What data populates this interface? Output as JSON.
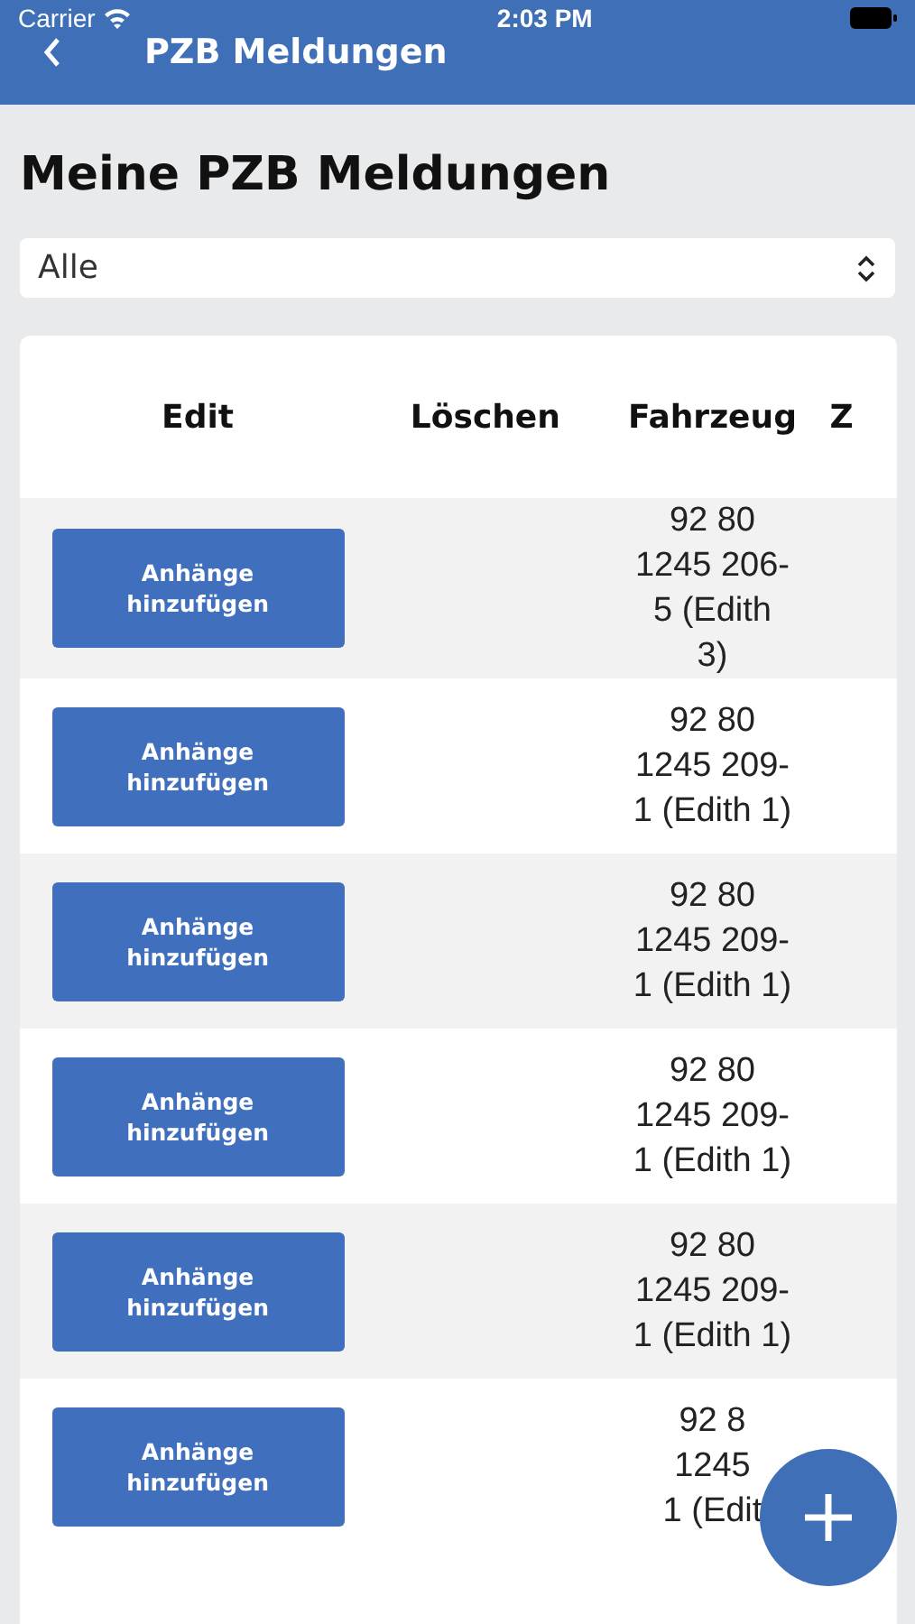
{
  "status_bar": {
    "carrier": "Carrier",
    "time": "2:03 PM"
  },
  "nav_bar": {
    "title": "PZB Meldungen"
  },
  "heading": "Meine PZB Meldungen",
  "filter": {
    "value": "Alle"
  },
  "table": {
    "columns": [
      "Edit",
      "Löschen",
      "Fahrzeug",
      "Z"
    ],
    "rows": [
      {
        "edit": "Anhänge hinzufügen",
        "fahrzeug": [
          "92 80",
          "1245 206-",
          "5 (Edith",
          "3)"
        ]
      },
      {
        "edit": "Anhänge hinzufügen",
        "fahrzeug": [
          "92 80",
          "1245 209-",
          "1 (Edith 1)"
        ]
      },
      {
        "edit": "Anhänge hinzufügen",
        "fahrzeug": [
          "92 80",
          "1245 209-",
          "1 (Edith 1)"
        ]
      },
      {
        "edit": "Anhänge hinzufügen",
        "fahrzeug": [
          "92 80",
          "1245 209-",
          "1 (Edith 1)"
        ]
      },
      {
        "edit": "Anhänge hinzufügen",
        "fahrzeug": [
          "92 80",
          "1245 209-",
          "1 (Edith 1)"
        ]
      },
      {
        "edit": "Anhänge hinzufügen",
        "fahrzeug": [
          "92 8",
          "1245",
          "1 (Edit"
        ]
      }
    ]
  }
}
